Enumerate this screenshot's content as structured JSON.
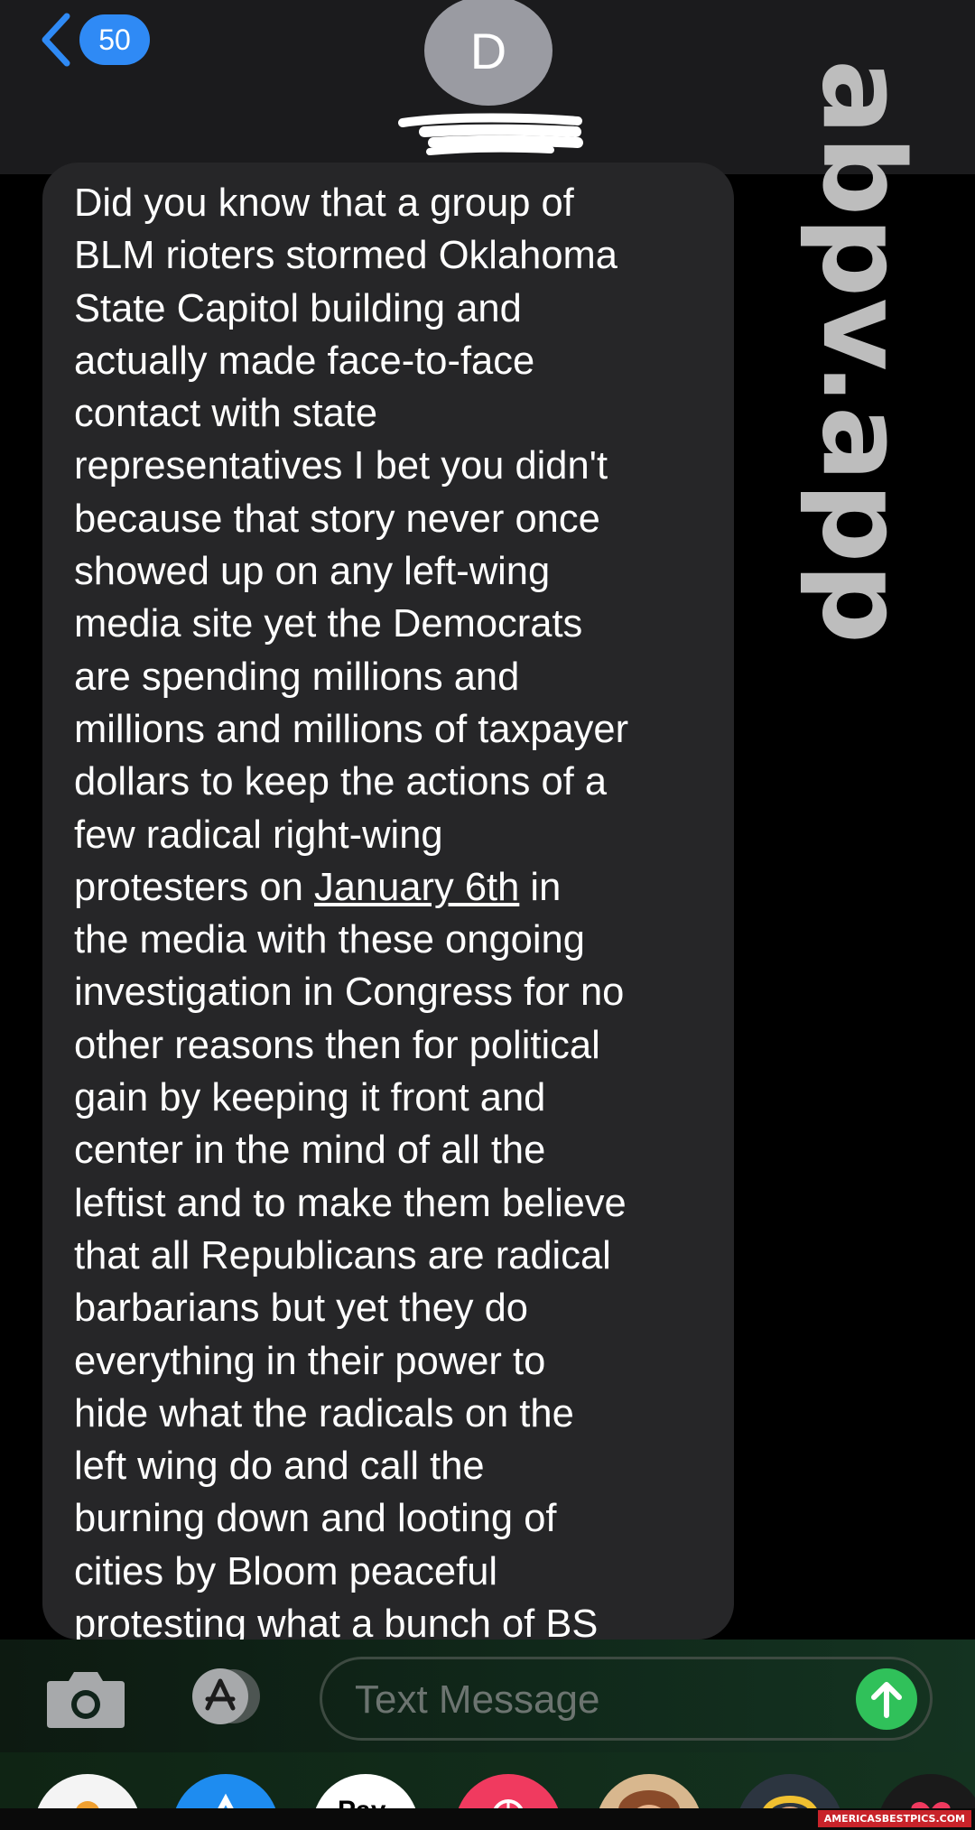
{
  "header": {
    "back_count": "50",
    "contact_initial": "D"
  },
  "watermark": "abpv.app",
  "message": {
    "before_link": "Did you know that a group of\nBLM rioters stormed Oklahoma\nState Capitol building and\nactually made face-to-face\ncontact with state\nrepresentatives I bet you didn't\nbecause that story never once\nshowed up on any left-wing\nmedia site yet the Democrats\nare spending millions and\nmillions and millions of taxpayer\ndollars to keep the actions of a\nfew radical right-wing\nprotesters on ",
    "link": "January 6th",
    "after_link": " in\nthe media with these ongoing\ninvestigation in Congress for no\nother reasons then for political\ngain by keeping it front and\ncenter in the mind of all the\nleftist and to make them believe\nthat all Republicans are radical\nbarbarians but yet they do\neverything in their power to\nhide what the radicals on the\nleft wing do and call the\nburning down and looting of\ncities by Bloom peaceful\nprotesting what a bunch of BS"
  },
  "composer": {
    "placeholder": "Text Message"
  },
  "tray": {
    "apple_pay_label": "Pay",
    "apps": [
      "photos-app-icon",
      "app-store-app-icon",
      "apple-pay-app-icon",
      "search-images-app-icon",
      "memoji-app-icon",
      "memoji-app-icon",
      "digital-touch-app-icon"
    ]
  },
  "credit": "AMERICASBESTPICS.COM",
  "colors": {
    "accent_blue": "#2f8af5",
    "send_green": "#30c15a",
    "bubble_gray": "#262628"
  }
}
